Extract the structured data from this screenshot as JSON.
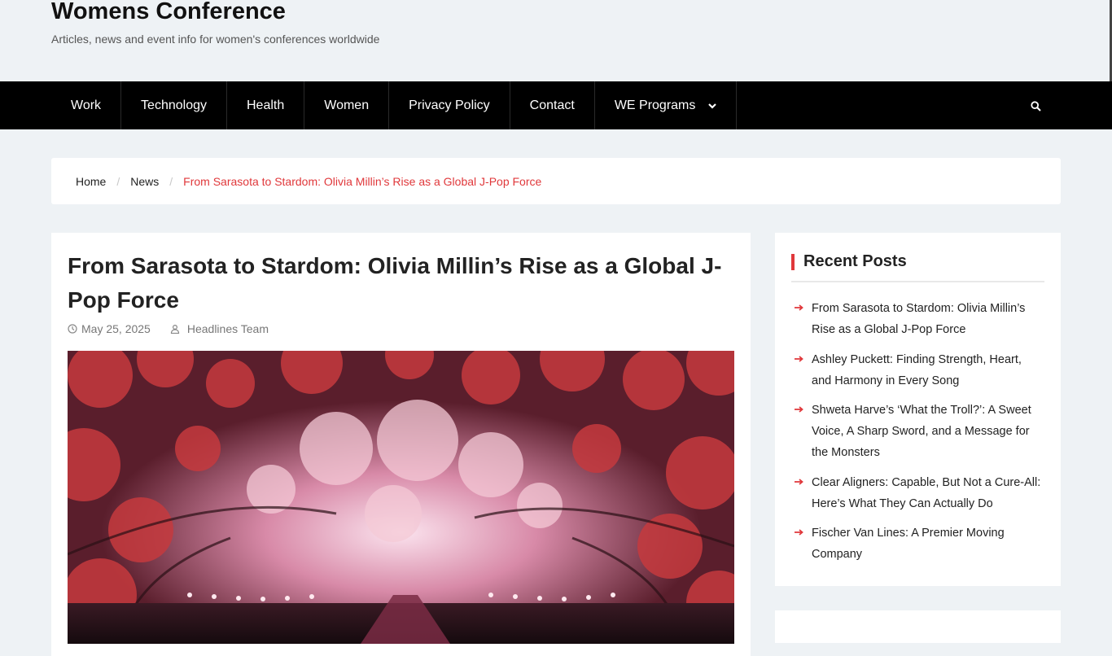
{
  "site": {
    "title": "Womens Conference",
    "description": "Articles, news and event info for women's conferences worldwide"
  },
  "nav": {
    "items": [
      {
        "label": "Work"
      },
      {
        "label": "Technology"
      },
      {
        "label": "Health"
      },
      {
        "label": "Women"
      },
      {
        "label": "Privacy Policy"
      },
      {
        "label": "Contact"
      },
      {
        "label": "WE Programs"
      }
    ],
    "search_icon": "search-icon",
    "dropdown_icon": "chevron-down-icon"
  },
  "breadcrumb": {
    "items": [
      "Home",
      "News",
      "From Sarasota to Stardom: Olivia Millin’s Rise as a Global J-Pop Force"
    ],
    "separator": "/"
  },
  "article": {
    "title": "From Sarasota to Stardom: Olivia Millin’s Rise as a Global J-Pop Force",
    "date": "May 25, 2025",
    "author": "Headlines Team"
  },
  "sidebar": {
    "recent_posts_title": "Recent Posts",
    "posts": [
      "From Sarasota to Stardom: Olivia Millin’s Rise as a Global J-Pop Force",
      "Ashley Puckett: Finding Strength, Heart, and Harmony in Every Song",
      "Shweta Harve’s ‘What the Troll?’: A Sweet Voice, A Sharp Sword, and a Message for the Monsters",
      "Clear Aligners: Capable, But Not a Cure-All: Here’s What They Can Actually Do",
      "Fischer Van Lines: A Premier Moving Company"
    ]
  },
  "colors": {
    "accent": "#e0383b",
    "nav_bg": "#000000",
    "page_bg": "#eef2f5"
  }
}
